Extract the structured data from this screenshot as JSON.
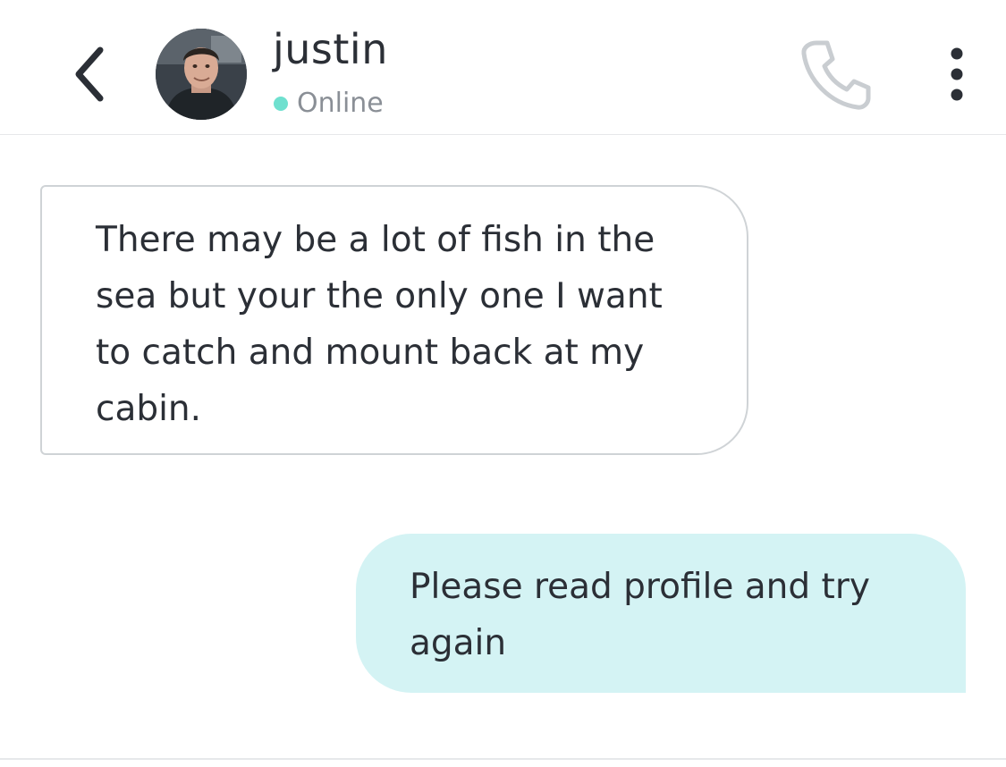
{
  "header": {
    "contact_name": "justin",
    "status": "Online",
    "status_color": "#6fe0cf",
    "back_icon": "chevron-left-icon",
    "call_icon": "phone-icon",
    "more_icon": "more-vertical-icon"
  },
  "messages": [
    {
      "direction": "incoming",
      "text": "There may be a lot of fish in the sea but your the only one I want to catch and mount back at my cabin."
    },
    {
      "direction": "outgoing",
      "text": "Please read profile and try again"
    }
  ],
  "colors": {
    "outgoing_bubble": "#d4f3f4",
    "incoming_border": "#cfd3d6",
    "text": "#2b2f36"
  }
}
